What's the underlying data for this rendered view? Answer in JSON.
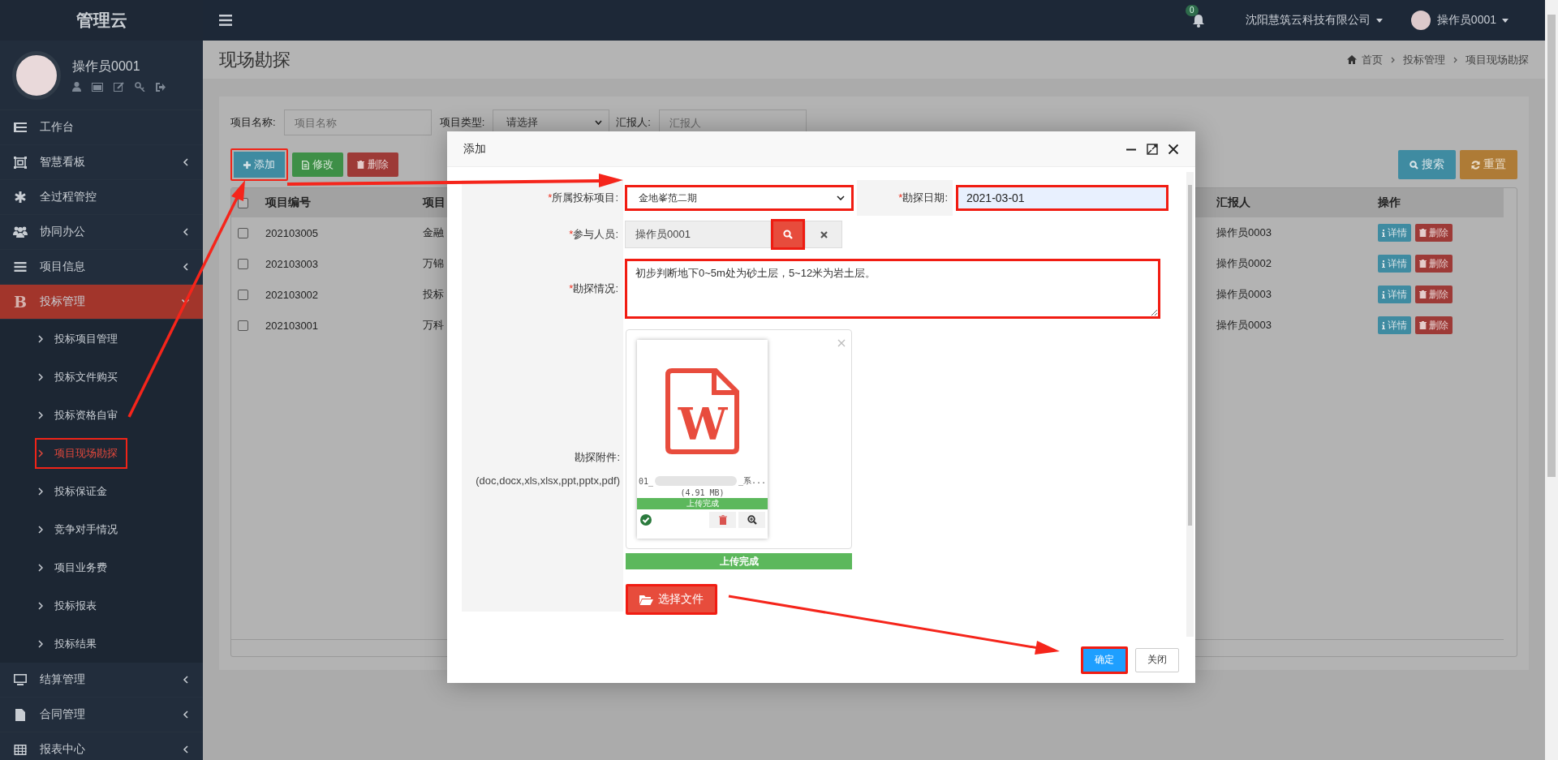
{
  "sidebar": {
    "brand": "管理云",
    "user": {
      "name": "操作员0001"
    },
    "menu": [
      {
        "kind": "link",
        "label": "工作台",
        "selected": false
      },
      {
        "kind": "group",
        "label": "智慧看板",
        "expanded": false,
        "selected": false
      },
      {
        "kind": "link",
        "label": "全过程管控",
        "selected": false
      },
      {
        "kind": "group",
        "label": "协同办公",
        "expanded": false,
        "selected": false
      },
      {
        "kind": "group",
        "label": "项目信息",
        "expanded": false,
        "selected": false
      },
      {
        "kind": "group",
        "label": "投标管理",
        "glyph": "B",
        "expanded": true,
        "selected": true,
        "children": [
          {
            "label": "投标项目管理",
            "selected": false,
            "highlighted": false
          },
          {
            "label": "投标文件购买",
            "selected": false,
            "highlighted": false
          },
          {
            "label": "投标资格自审",
            "selected": false,
            "highlighted": false
          },
          {
            "label": "项目现场勘探",
            "selected": true,
            "highlighted": true
          },
          {
            "label": "投标保证金",
            "selected": false,
            "highlighted": false
          },
          {
            "label": "竞争对手情况",
            "selected": false,
            "highlighted": false
          },
          {
            "label": "项目业务费",
            "selected": false,
            "highlighted": false
          },
          {
            "label": "投标报表",
            "selected": false,
            "highlighted": false
          },
          {
            "label": "投标结果",
            "selected": false,
            "highlighted": false
          }
        ]
      },
      {
        "kind": "group",
        "label": "结算管理",
        "expanded": false,
        "selected": false
      },
      {
        "kind": "group",
        "label": "合同管理",
        "expanded": false,
        "selected": false
      },
      {
        "kind": "group",
        "label": "报表中心",
        "expanded": false,
        "selected": false
      }
    ]
  },
  "top_bar": {
    "notification_count": "0",
    "company": "沈阳慧筑云科技有限公司",
    "user": "操作员0001"
  },
  "page": {
    "title": "现场勘探",
    "breadcrumb": [
      "首页",
      "投标管理",
      "项目现场勘探"
    ]
  },
  "filters": [
    {
      "kind": "input",
      "label": "项目名称:",
      "placeholder": "项目名称"
    },
    {
      "kind": "select",
      "label": "项目类型:",
      "value": "请选择"
    },
    {
      "kind": "input",
      "label": "汇报人:",
      "placeholder": "汇报人"
    }
  ],
  "toolbar": {
    "left": [
      {
        "kind": "add",
        "label": "添加",
        "highlighted": true
      },
      {
        "kind": "edit",
        "label": "修改",
        "highlighted": false
      },
      {
        "kind": "delete",
        "label": "删除",
        "highlighted": false
      }
    ],
    "right": [
      {
        "kind": "search",
        "label": "搜索"
      },
      {
        "kind": "reset",
        "label": "重置"
      }
    ]
  },
  "table": {
    "all_checked": false,
    "columns": [
      "项目编号",
      "项目",
      "汇报人",
      "操作"
    ],
    "rows": [
      {
        "checked": false,
        "code": "202103005",
        "name": "金融",
        "reporter": "操作员0003",
        "actions": [
          "详情",
          "删除"
        ]
      },
      {
        "checked": false,
        "code": "202103003",
        "name": "万锦",
        "reporter": "操作员0002",
        "actions": [
          "详情",
          "删除"
        ]
      },
      {
        "checked": false,
        "code": "202103002",
        "name": "投标",
        "reporter": "操作员0003",
        "actions": [
          "详情",
          "删除"
        ]
      },
      {
        "checked": false,
        "code": "202103001",
        "name": "万科",
        "reporter": "操作员0003",
        "actions": [
          "详情",
          "删除"
        ]
      }
    ]
  },
  "dialog": {
    "title": "添加",
    "project": {
      "mark": "*",
      "label": "所属投标项目:",
      "value": "金地峯范二期",
      "highlighted": true
    },
    "date": {
      "mark": "*",
      "label": "勘探日期:",
      "value": "2021-03-01",
      "highlighted": true
    },
    "participants": {
      "mark": "*",
      "label": "参与人员:",
      "value": "操作员0001",
      "search_highlighted": true
    },
    "survey": {
      "mark": "*",
      "label": "勘探情况:",
      "value": "初步判断地下0~5m处为砂土层，5~12米为岩土层。",
      "highlighted": true
    },
    "attachment": {
      "label": "勘探附件:",
      "hint": "(doc,docx,xls,xlsx,ppt,pptx,pdf)",
      "files": [
        {
          "icon_letter": "W",
          "name_start": "01_",
          "name_end": "_系...",
          "size": "(4.91 MB)",
          "status": "上传完成",
          "level": 1,
          "uploaded": true
        }
      ],
      "progress": {
        "label": "上传完成",
        "level": 1
      },
      "choose_button": {
        "label": "选择文件",
        "highlighted": true
      }
    },
    "buttons": [
      {
        "kind": "primary",
        "label": "确定",
        "highlighted": true
      },
      {
        "kind": "default",
        "label": "关闭",
        "highlighted": false
      }
    ]
  }
}
